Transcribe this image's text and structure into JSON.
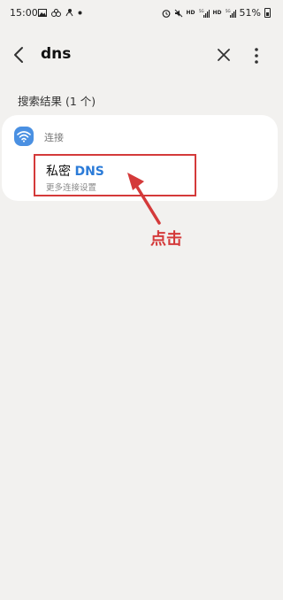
{
  "status_bar": {
    "time": "15:00",
    "battery": "51%",
    "network_labels": [
      "HD",
      "5G",
      "HD",
      "5G"
    ]
  },
  "appbar": {
    "query": "dns"
  },
  "results": {
    "heading": "搜索结果 (1 个)",
    "category": "连接",
    "item": {
      "title_prefix": "私密 ",
      "title_highlight": "DNS",
      "subtitle": "更多连接设置"
    }
  },
  "annotation": {
    "label": "点击",
    "color": "#d43a3a"
  },
  "colors": {
    "background": "#f2f1ef",
    "accent": "#2b7bd8",
    "wifi_icon_bg": "#4a90e2"
  }
}
